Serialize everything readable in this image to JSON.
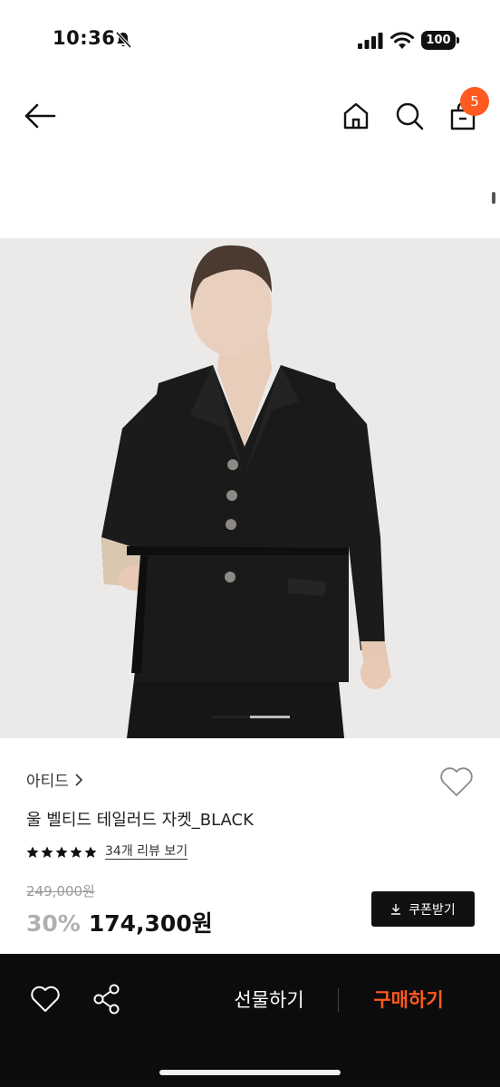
{
  "status_bar": {
    "time": "10:36",
    "battery": "100"
  },
  "nav": {
    "cart_count": "5"
  },
  "product": {
    "brand": "아티드",
    "title": "울 벨티드 테일러드 자켓_BLACK",
    "rating_stars": 5,
    "review_link": "34개 리뷰 보기",
    "original_price": "249,000원",
    "discount": "30%",
    "sale_price": "174,300원",
    "coupon_label": "쿠폰받기"
  },
  "gallery": {
    "pages": 2,
    "current": 1
  },
  "bottom_bar": {
    "gift_label": "선물하기",
    "buy_label": "구매하기"
  },
  "colors": {
    "accent": "#ff5a1f",
    "bar_bg": "#0c0c0c",
    "button_bg": "#111111"
  }
}
